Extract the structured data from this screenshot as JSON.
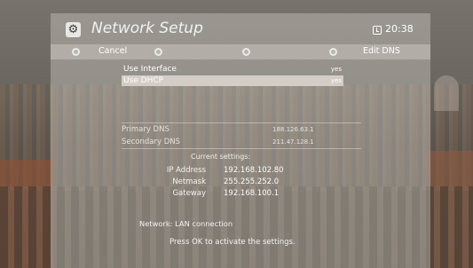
{
  "header": {
    "title": "Network Setup",
    "icon": "gear-icon",
    "time": "20:38",
    "time_icon": "clock-icon"
  },
  "buttons": {
    "cancel": "Cancel",
    "edit_dns": "Edit DNS"
  },
  "menu": {
    "items": [
      {
        "label": "Use Interface",
        "value": "yes",
        "selected": false
      },
      {
        "label": "Use DHCP",
        "value": "yes",
        "selected": true
      }
    ]
  },
  "dns": {
    "primary_label": "Primary DNS",
    "primary_value": "188.126.63.1",
    "secondary_label": "Secondary DNS",
    "secondary_value": "211.47.128.1"
  },
  "settings": {
    "title": "Current settings:",
    "ip_label": "IP Address",
    "ip_value": "192.168.102.80",
    "netmask_label": "Netmask",
    "netmask_value": "255.255.252.0",
    "gateway_label": "Gateway",
    "gateway_value": "192.168.100.1"
  },
  "network": {
    "text": "Network:  LAN connection"
  },
  "footer": {
    "hint": "Press OK to activate the settings."
  },
  "colors": {
    "selection": "#d3cdc6",
    "panel": "#cecac4"
  }
}
